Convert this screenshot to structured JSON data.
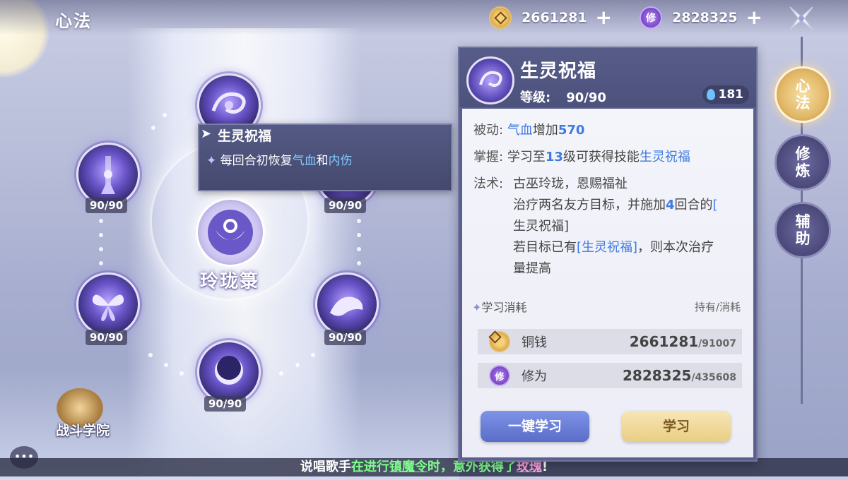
{
  "header": {
    "title": "心法"
  },
  "resources": [
    {
      "name": "coin",
      "value": "2661281"
    },
    {
      "name": "xiuwei",
      "icon_text": "修",
      "value": "2828325"
    }
  ],
  "center": {
    "label": "玲珑箓"
  },
  "skills": [
    {
      "name": "生灵祝福",
      "level": "90/90"
    },
    {
      "name": "skill-left-top",
      "level": "90/90"
    },
    {
      "name": "skill-right-top",
      "level": "90/90"
    },
    {
      "name": "skill-left-bottom",
      "level": "90/90"
    },
    {
      "name": "skill-right-bottom",
      "level": "90/90"
    },
    {
      "name": "skill-bottom",
      "level": "90/90"
    }
  ],
  "tooltip": {
    "title": "生灵祝福",
    "body_pre": "每回合初恢复",
    "hl1": "气血",
    "mid": "和",
    "hl2": "内伤"
  },
  "academy": {
    "label": "战斗学院"
  },
  "chat": {
    "icon": "chat-icon"
  },
  "ticker": {
    "pre": "说唱歌手",
    "g1": "在进行",
    "g2": "镇魔令",
    "g3": "时，意外获得了",
    "p": "玫瑰",
    "end": "!"
  },
  "panel": {
    "name": "生灵祝福",
    "level_label": "等级:",
    "level_value": "90/90",
    "points": "181",
    "passive_label": "被动:",
    "passive_hl": "气血",
    "passive_text": "增加",
    "passive_num": "570",
    "master_label": "掌握:",
    "master_pre": "学习至",
    "master_num": "13",
    "master_mid": "级可获得技能",
    "master_skill": "生灵祝福",
    "spell_label": "法术:",
    "spell_line1": "古巫玲珑，恩赐福祉",
    "spell_line2_pre": "治疗两名友方目标，并施加",
    "spell_line2_num": "4",
    "spell_line2_post": "回合的",
    "spell_line3_open": "[",
    "spell_line3": "生灵祝福]",
    "spell_line4_pre": "若目标已有",
    "spell_line4_hl": "[生灵祝福]",
    "spell_line4_post": "，则本次治疗",
    "spell_line5": "量提高",
    "cost_title": "学习消耗",
    "cost_sub": "持有/消耗",
    "costs": [
      {
        "label": "铜钱",
        "have": "2661281",
        "need": "/91007"
      },
      {
        "label": "修为",
        "have": "2828325",
        "need": "/435608"
      }
    ],
    "btn_one": "一键学习",
    "btn_learn": "学习"
  },
  "tabs": [
    {
      "label": "心法",
      "active": true
    },
    {
      "label": "修炼",
      "active": false
    },
    {
      "label": "辅助",
      "active": false
    }
  ]
}
